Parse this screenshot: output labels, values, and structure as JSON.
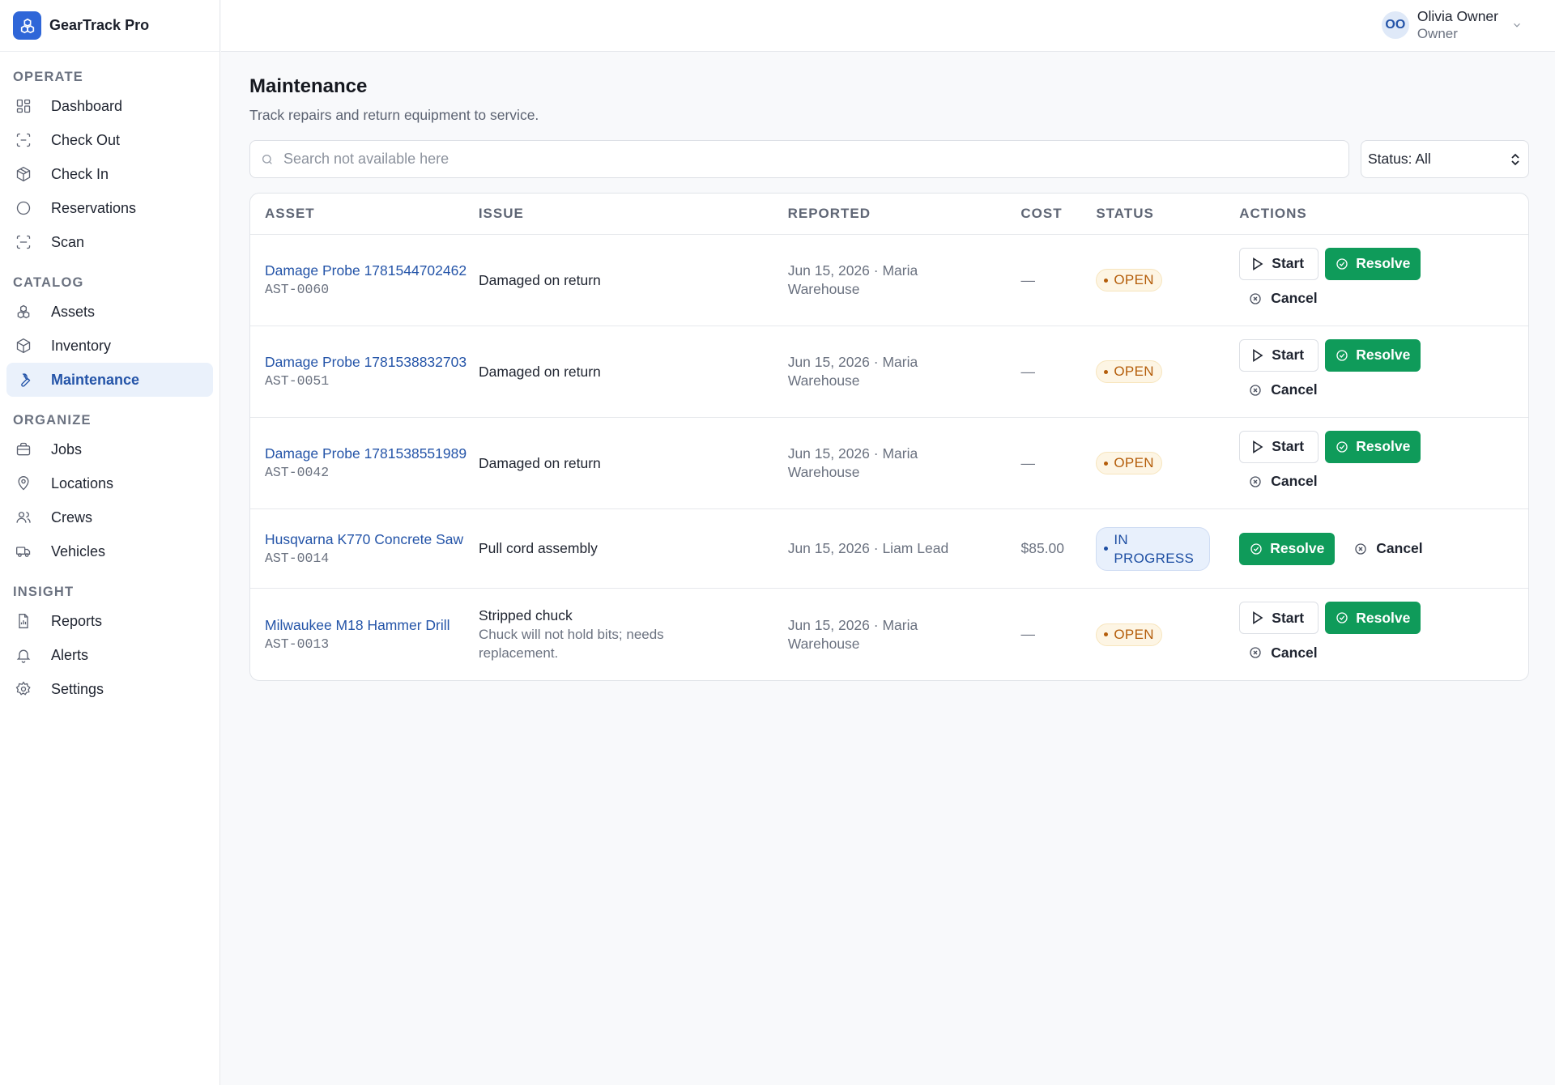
{
  "app": {
    "name": "GearTrack Pro"
  },
  "user": {
    "initials": "OO",
    "name": "Olivia Owner",
    "role": "Owner"
  },
  "sidebar": {
    "sections": [
      {
        "heading": "OPERATE",
        "items": [
          {
            "label": "Dashboard",
            "icon": "dashboard-icon"
          },
          {
            "label": "Check Out",
            "icon": "check-out-icon"
          },
          {
            "label": "Check In",
            "icon": "check-in-icon"
          },
          {
            "label": "Reservations",
            "icon": "reservations-icon"
          },
          {
            "label": "Scan",
            "icon": "scan-icon"
          }
        ]
      },
      {
        "heading": "CATALOG",
        "items": [
          {
            "label": "Assets",
            "icon": "assets-icon"
          },
          {
            "label": "Inventory",
            "icon": "inventory-icon"
          },
          {
            "label": "Maintenance",
            "icon": "wrench-icon",
            "active": true
          }
        ]
      },
      {
        "heading": "ORGANIZE",
        "items": [
          {
            "label": "Jobs",
            "icon": "briefcase-icon"
          },
          {
            "label": "Locations",
            "icon": "map-pin-icon"
          },
          {
            "label": "Crews",
            "icon": "users-icon"
          },
          {
            "label": "Vehicles",
            "icon": "truck-icon"
          }
        ]
      },
      {
        "heading": "INSIGHT",
        "items": [
          {
            "label": "Reports",
            "icon": "report-icon"
          },
          {
            "label": "Alerts",
            "icon": "bell-icon"
          },
          {
            "label": "Settings",
            "icon": "gear-icon"
          }
        ]
      }
    ]
  },
  "page": {
    "title": "Maintenance",
    "subtitle": "Track repairs and return equipment to service."
  },
  "search": {
    "placeholder": "Search not available here",
    "value": ""
  },
  "status_filter": {
    "selected": "Status: All"
  },
  "table": {
    "columns": [
      "ASSET",
      "ISSUE",
      "REPORTED",
      "COST",
      "STATUS",
      "ACTIONS"
    ],
    "rows": [
      {
        "asset_name": "Damage Probe 1781544702462",
        "asset_tag": "AST-0060",
        "issue": "Damaged on return",
        "issue_desc": "",
        "reported": "Jun 15, 2026 · Maria Warehouse",
        "cost": "—",
        "status": "OPEN"
      },
      {
        "asset_name": "Damage Probe 1781538832703",
        "asset_tag": "AST-0051",
        "issue": "Damaged on return",
        "issue_desc": "",
        "reported": "Jun 15, 2026 · Maria Warehouse",
        "cost": "—",
        "status": "OPEN"
      },
      {
        "asset_name": "Damage Probe 1781538551989",
        "asset_tag": "AST-0042",
        "issue": "Damaged on return",
        "issue_desc": "",
        "reported": "Jun 15, 2026 · Maria Warehouse",
        "cost": "—",
        "status": "OPEN"
      },
      {
        "asset_name": "Husqvarna K770 Concrete Saw",
        "asset_tag": "AST-0014",
        "issue": "Pull cord assembly",
        "issue_desc": "",
        "reported": "Jun 15, 2026 · Liam Lead",
        "cost": "$85.00",
        "status": "IN PROGRESS"
      },
      {
        "asset_name": "Milwaukee M18 Hammer Drill",
        "asset_tag": "AST-0013",
        "issue": "Stripped chuck",
        "issue_desc": "Chuck will not hold bits; needs replacement.",
        "reported": "Jun 15, 2026 · Maria Warehouse",
        "cost": "—",
        "status": "OPEN"
      }
    ],
    "actions": {
      "start": "Start",
      "resolve": "Resolve",
      "cancel": "Cancel"
    }
  },
  "colors": {
    "accent": "#2454a8",
    "resolve": "#0f9b5a",
    "open": "#b45d0a",
    "in_progress": "#1e4fa3"
  }
}
